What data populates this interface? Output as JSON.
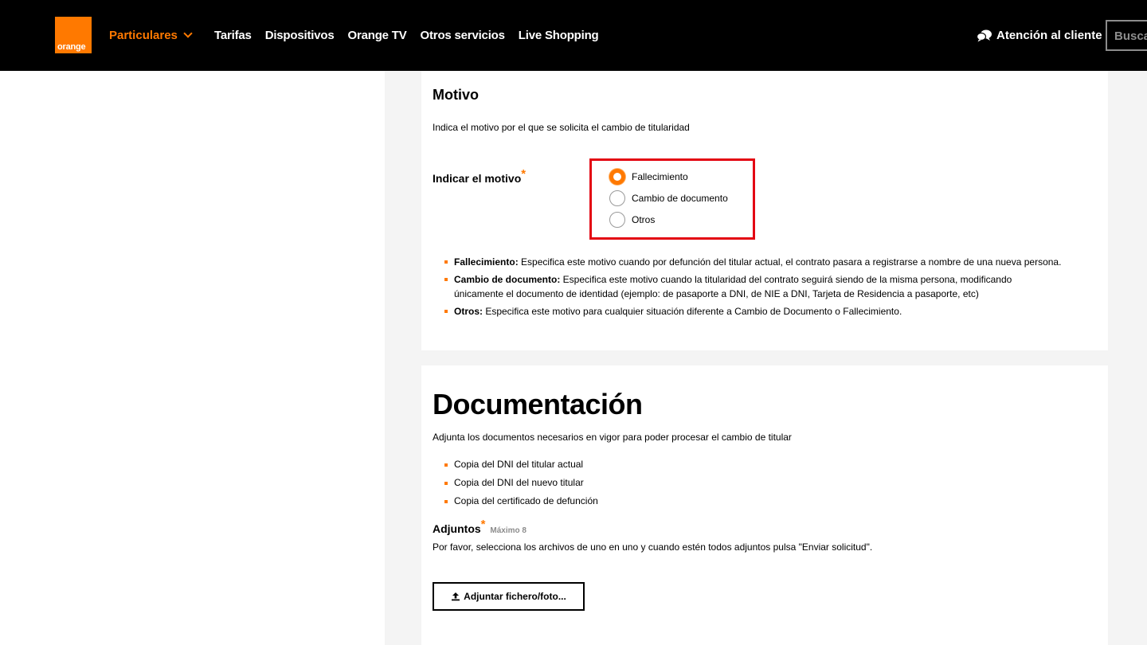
{
  "header": {
    "logo_text": "orange",
    "particulares": "Particulares",
    "nav": [
      "Tarifas",
      "Dispositivos",
      "Orange TV",
      "Otros servicios",
      "Live Shopping"
    ],
    "attention": "Atención al cliente",
    "search_placeholder": "Busca",
    "brand_color": "#ff7900"
  },
  "motivo": {
    "title": "Motivo",
    "subtitle": "Indica el motivo por el que se solicita el cambio de titularidad",
    "field_label": "Indicar el motivo",
    "required_mark": "*",
    "options": [
      {
        "label": "Fallecimiento",
        "checked": true
      },
      {
        "label": "Cambio de documento",
        "checked": false
      },
      {
        "label": "Otros",
        "checked": false
      }
    ],
    "descriptions": [
      {
        "term": "Fallecimiento:",
        "text": " Especifica este motivo cuando por defunción del titular actual, el contrato pasara a registrarse a nombre de una nueva persona."
      },
      {
        "term": "Cambio de documento:",
        "text": " Especifica este motivo cuando la titularidad del contrato seguirá siendo de la misma persona, modificando únicamente el documento de identidad (ejemplo: de pasaporte a DNI, de NIE a DNI, Tarjeta de Residencia a pasaporte, etc)"
      },
      {
        "term": "Otros:",
        "text": " Especifica este motivo para cualquier situación diferente a Cambio de Documento o Fallecimiento."
      }
    ]
  },
  "documentacion": {
    "title": "Documentación",
    "subtitle": "Adjunta los documentos necesarios en vigor para poder procesar el cambio de titular",
    "items": [
      "Copia del DNI del titular actual",
      "Copia del DNI del nuevo titular",
      "Copia del certificado de defunción"
    ],
    "adjuntos_label": "Adjuntos",
    "adjuntos_max": "Máximo 8",
    "adjuntos_help": "Por favor, selecciona los archivos de uno en uno y cuando estén todos adjuntos pulsa \"Enviar solicitud\".",
    "attach_button": "Adjuntar fichero/foto..."
  }
}
